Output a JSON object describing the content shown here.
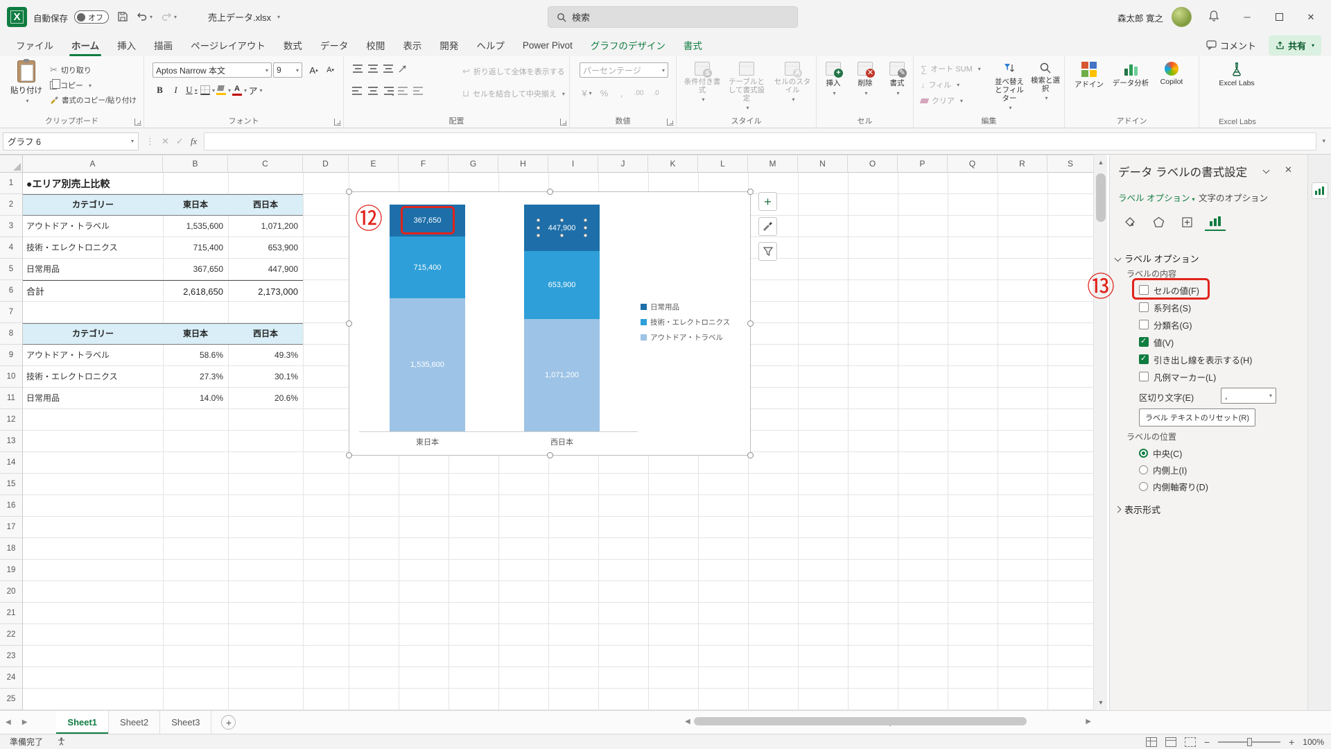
{
  "titlebar": {
    "autosave_label": "自動保存",
    "autosave_state": "オフ",
    "filename": "売上データ.xlsx",
    "search_placeholder": "検索",
    "user_name": "森太郎 寛之"
  },
  "ribbon_tabs": {
    "items": [
      {
        "label": "ファイル"
      },
      {
        "label": "ホーム"
      },
      {
        "label": "挿入"
      },
      {
        "label": "描画"
      },
      {
        "label": "ページレイアウト"
      },
      {
        "label": "数式"
      },
      {
        "label": "データ"
      },
      {
        "label": "校閲"
      },
      {
        "label": "表示"
      },
      {
        "label": "開発"
      },
      {
        "label": "ヘルプ"
      },
      {
        "label": "Power Pivot"
      }
    ],
    "contextual": [
      {
        "label": "グラフのデザイン"
      },
      {
        "label": "書式"
      }
    ],
    "comment_button": "コメント",
    "share_button": "共有"
  },
  "ribbon": {
    "paste": "貼り付け",
    "cut": "切り取り",
    "copy": "コピー",
    "format_painter": "書式のコピー/貼り付け",
    "group_clipboard": "クリップボード",
    "font_name": "Aptos Narrow 本文",
    "font_size": "9",
    "bold": "B",
    "italic": "I",
    "underline": "U",
    "font_grow": "A",
    "font_shrink": "A",
    "phonetic": "ア",
    "group_font": "フォント",
    "wrap_text": "折り返して全体を表示する",
    "merge_center": "セルを結合して中央揃え",
    "group_align": "配置",
    "number_format": "パーセンテージ",
    "currency": "¥",
    "percent": "%",
    "comma": ",",
    "inc_decimal": ".00",
    "dec_decimal": ".0",
    "group_number": "数値",
    "conditional_formatting": "条件付き書式",
    "format_as_table": "テーブルとして書式設定",
    "cell_styles": "セルのスタイル",
    "group_styles": "スタイル",
    "insert": "挿入",
    "delete": "削除",
    "format": "書式",
    "group_cells": "セル",
    "autosum": "オート SUM",
    "fill": "フィル",
    "clear": "クリア",
    "sort_filter": "並べ替えとフィルター",
    "find_select": "検索と選択",
    "group_editing": "編集",
    "addins": "アドイン",
    "data_analysis": "データ分析",
    "copilot": "Copilot",
    "excel_labs": "Excel Labs"
  },
  "formula_bar": {
    "name_box": "グラフ 6",
    "fx": "fx"
  },
  "grid": {
    "columns": [
      "A",
      "B",
      "C",
      "D",
      "E",
      "F",
      "G",
      "H",
      "I",
      "J",
      "K",
      "L",
      "M",
      "N",
      "O",
      "P",
      "Q",
      "R",
      "S"
    ],
    "rows": [
      "1",
      "2",
      "3",
      "4",
      "5",
      "6",
      "7",
      "8",
      "9",
      "10",
      "11",
      "12",
      "13",
      "14",
      "15",
      "16",
      "17",
      "18",
      "19",
      "20",
      "21",
      "22",
      "23",
      "24",
      "25"
    ],
    "cells": {
      "a1": "●エリア別売上比較",
      "t1_headers": [
        "カテゴリー",
        "東日本",
        "西日本"
      ],
      "t1_rows": [
        [
          "アウトドア・トラベル",
          "1,535,600",
          "1,071,200"
        ],
        [
          "技術・エレクトロニクス",
          "715,400",
          "653,900"
        ],
        [
          "日常用品",
          "367,650",
          "447,900"
        ]
      ],
      "t1_total": [
        "合計",
        "2,618,650",
        "2,173,000"
      ],
      "t2_headers": [
        "カテゴリー",
        "東日本",
        "西日本"
      ],
      "t2_rows": [
        [
          "アウトドア・トラベル",
          "58.6%",
          "49.3%"
        ],
        [
          "技術・エレクトロニクス",
          "27.3%",
          "30.1%"
        ],
        [
          "日常用品",
          "14.0%",
          "20.6%"
        ]
      ]
    }
  },
  "chart_data": {
    "type": "bar",
    "subtype": "100%-stacked-column",
    "title": "",
    "categories": [
      "東日本",
      "西日本"
    ],
    "series": [
      {
        "name": "アウトドア・トラベル",
        "values": [
          1535600,
          1071200
        ],
        "labels": [
          "1,535,600",
          "1,071,200"
        ],
        "color": "#9DC3E6"
      },
      {
        "name": "技術・エレクトロニクス",
        "values": [
          715400,
          653900
        ],
        "labels": [
          "715,400",
          "653,900"
        ],
        "color": "#2E9FD8"
      },
      {
        "name": "日常用品",
        "values": [
          367650,
          447900
        ],
        "labels": [
          "367,650",
          "447,900"
        ],
        "color": "#1E6FA9"
      }
    ],
    "legend": [
      "日常用品",
      "技術・エレクトロニクス",
      "アウトドア・トラベル"
    ],
    "legend_position": "right",
    "value_labels_visible": true,
    "axes_visible": false
  },
  "pane": {
    "title": "データ ラベルの書式設定",
    "tab1": "ラベル オプション",
    "tab2": "文字のオプション",
    "section_label_options": "ラベル オプション",
    "label_contains": "ラベルの内容",
    "cb_cell_value": "セルの値(F)",
    "cb_series_name": "系列名(S)",
    "cb_category_name": "分類名(G)",
    "cb_value": "値(V)",
    "cb_leader_lines": "引き出し線を表示する(H)",
    "cb_legend_key": "凡例マーカー(L)",
    "separator_label": "区切り文字(E)",
    "separator_value": ",",
    "reset_label": "ラベル テキストのリセット(R)",
    "section_position": "ラベルの位置",
    "rb_center": "中央(C)",
    "rb_inside_end": "内側上(I)",
    "rb_inside_base": "内側軸寄り(D)",
    "section_number_format": "表示形式"
  },
  "annotations": {
    "step12": "⑫",
    "step13": "⑬"
  },
  "sheet_bar": {
    "tabs": [
      "Sheet1",
      "Sheet2",
      "Sheet3"
    ],
    "add_label": "+"
  },
  "status_bar": {
    "ready": "準備完了",
    "zoom": "100%"
  }
}
